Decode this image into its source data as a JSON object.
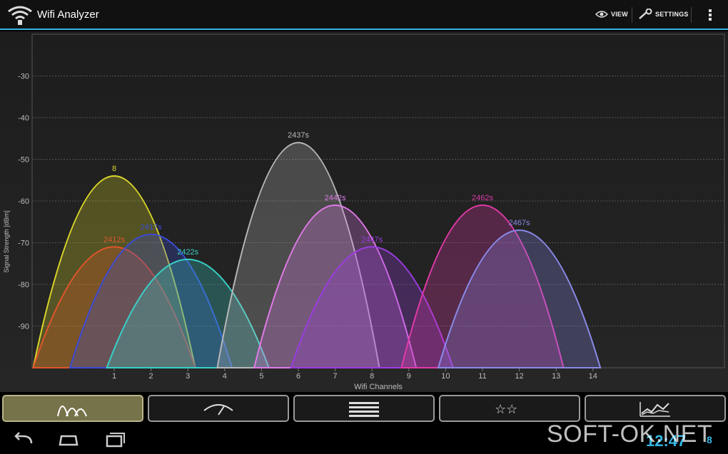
{
  "app": {
    "title": "Wifi Analyzer"
  },
  "actionbar": {
    "view_label": "VIEW",
    "settings_label": "SETTINGS"
  },
  "icons": [
    "wifi-logo-icon",
    "eye-icon",
    "wrench-icon",
    "overflow-menu-icon",
    "channel-graph-icon",
    "signal-meter-icon",
    "ap-list-icon",
    "channel-rating-icon",
    "time-graph-icon",
    "back-icon",
    "home-icon",
    "recent-apps-icon"
  ],
  "status": {
    "time": "12:47",
    "signal_indicator": "8"
  },
  "watermark": "SOFT-OK.NET",
  "colors": {
    "accent": "#33b5e5",
    "active_tab": "#76734a"
  },
  "chart_data": {
    "type": "area",
    "xlabel": "Wifi Channels",
    "ylabel": "Signal Strength [dBm]",
    "yticks": [
      -30,
      -40,
      -50,
      -60,
      -70,
      -80,
      -90
    ],
    "ylim": [
      -100,
      -20
    ],
    "xticks": [
      "1",
      "2",
      "3",
      "4",
      "5",
      "6",
      "7",
      "8",
      "9",
      "10",
      "11",
      "12",
      "13",
      "14"
    ],
    "series": [
      {
        "name": "8",
        "channel": 1,
        "dbm": -54,
        "color": "#d9d42a"
      },
      {
        "name": "2412s",
        "channel": 1,
        "dbm": -71,
        "color": "#e0552a"
      },
      {
        "name": "2417s",
        "channel": 2,
        "dbm": -68,
        "color": "#3a4ad8"
      },
      {
        "name": "2422s",
        "channel": 3,
        "dbm": -74,
        "color": "#38d0c8"
      },
      {
        "name": "2437s",
        "channel": 6,
        "dbm": -46,
        "color": "#b8b8b8"
      },
      {
        "name": "2442s",
        "channel": 7,
        "dbm": -61,
        "color": "#e07ae8"
      },
      {
        "name": "2447s",
        "channel": 8,
        "dbm": -71,
        "color": "#9a3ce0"
      },
      {
        "name": "2462s",
        "channel": 11,
        "dbm": -61,
        "color": "#e03aa8"
      },
      {
        "name": "2467s",
        "channel": 12,
        "dbm": -67,
        "color": "#8a8ae8"
      }
    ]
  }
}
